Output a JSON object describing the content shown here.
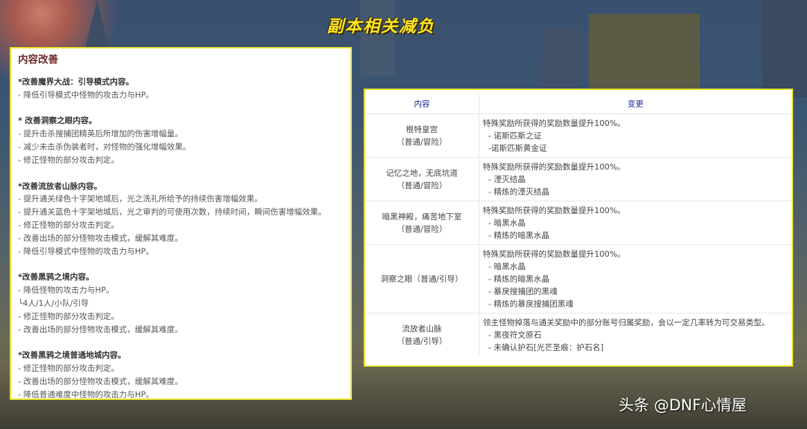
{
  "title": "副本相关减负",
  "left": {
    "heading": "内容改善",
    "sections": [
      {
        "title": "*改善魔界大战：引导模式内容。",
        "lines": [
          "- 降低引导模式中怪物的攻击力与HP。"
        ]
      },
      {
        "title": "* 改善洞察之眼内容。",
        "lines": [
          "- 提升击杀搜捕团精英后所增加的伤害增幅量。",
          "- 减少未击杀伪装者时，对怪物的强化增幅效果。",
          "- 修正怪物的部分攻击判定。"
        ]
      },
      {
        "title": "*改善流放者山脉内容。",
        "lines": [
          "- 提升通关绿色十字架地城后，光之洗礼所给予的持续伤害增幅效果。",
          "- 提升通关蓝色十字架地城后，光之审判的可使用次数，持续时间，瞬间伤害增幅效果。",
          "- 修正怪物的部分攻击判定。",
          "- 改善出场的部分怪物攻击模式，缓解其难度。",
          "- 降低引导模式中怪物的攻击力与HP。"
        ]
      },
      {
        "title": "*改善黑鸦之境内容。",
        "lines": [
          "- 降低怪物的攻击力与HP。",
          "└4人/1人/小队/引导",
          "- 修正怪物的部分攻击判定。",
          "- 改善出场的部分怪物攻击模式，缓解其难度。"
        ]
      },
      {
        "title": "*改善黑鸦之境普通地城内容。",
        "lines": [
          "- 修正怪物的部分攻击判定。",
          "- 改善出场的部分怪物攻击模式，缓解其难度。",
          "- 降低普通难度中怪物的攻击力与HP。"
        ]
      }
    ]
  },
  "table": {
    "headers": [
      "内容",
      "变更"
    ],
    "rows": [
      {
        "content": [
          "根特皇宫",
          "（普通/冒险）"
        ],
        "main": "特殊奖励所获得的奖励数量提升100%。",
        "subs": [
          "- 诺斯匹斯之证",
          "-诺斯匹斯黄金证"
        ]
      },
      {
        "content": [
          "记忆之地，无底坑道",
          "（普通/冒险）"
        ],
        "main": "特殊奖励所获得的奖励数量提升100%。",
        "subs": [
          "- 湮灭结晶",
          "- 精炼的湮灭结晶"
        ]
      },
      {
        "content": [
          "暗黑神殿，痛苦地下室",
          "（普通/冒险）"
        ],
        "main": "特殊奖励所获得的奖励数量提升100%。",
        "subs": [
          "- 暗黑水晶",
          "- 精炼的暗黑水晶"
        ]
      },
      {
        "content": [
          "洞察之眼（普通/引导）"
        ],
        "main": "特殊奖励所获得的奖励数量提升100%。",
        "subs": [
          "- 暗黑水晶",
          "- 精炼的暗黑水晶",
          "- 暴戾搜捕团的黑魂",
          "- 精炼的暴戾搜捕团黑魂"
        ]
      },
      {
        "content": [
          "流放者山脉",
          "（普通/引导）"
        ],
        "main": "领主怪物掉落与通关奖励中的部分账号归属奖励，会以一定几率转为可交易类型。",
        "subs": [
          "- 黑夜符文原石",
          "- 未确认护石[光芒圣痕：护石名]"
        ]
      }
    ]
  },
  "watermark": "头条 @DNF心情屋"
}
